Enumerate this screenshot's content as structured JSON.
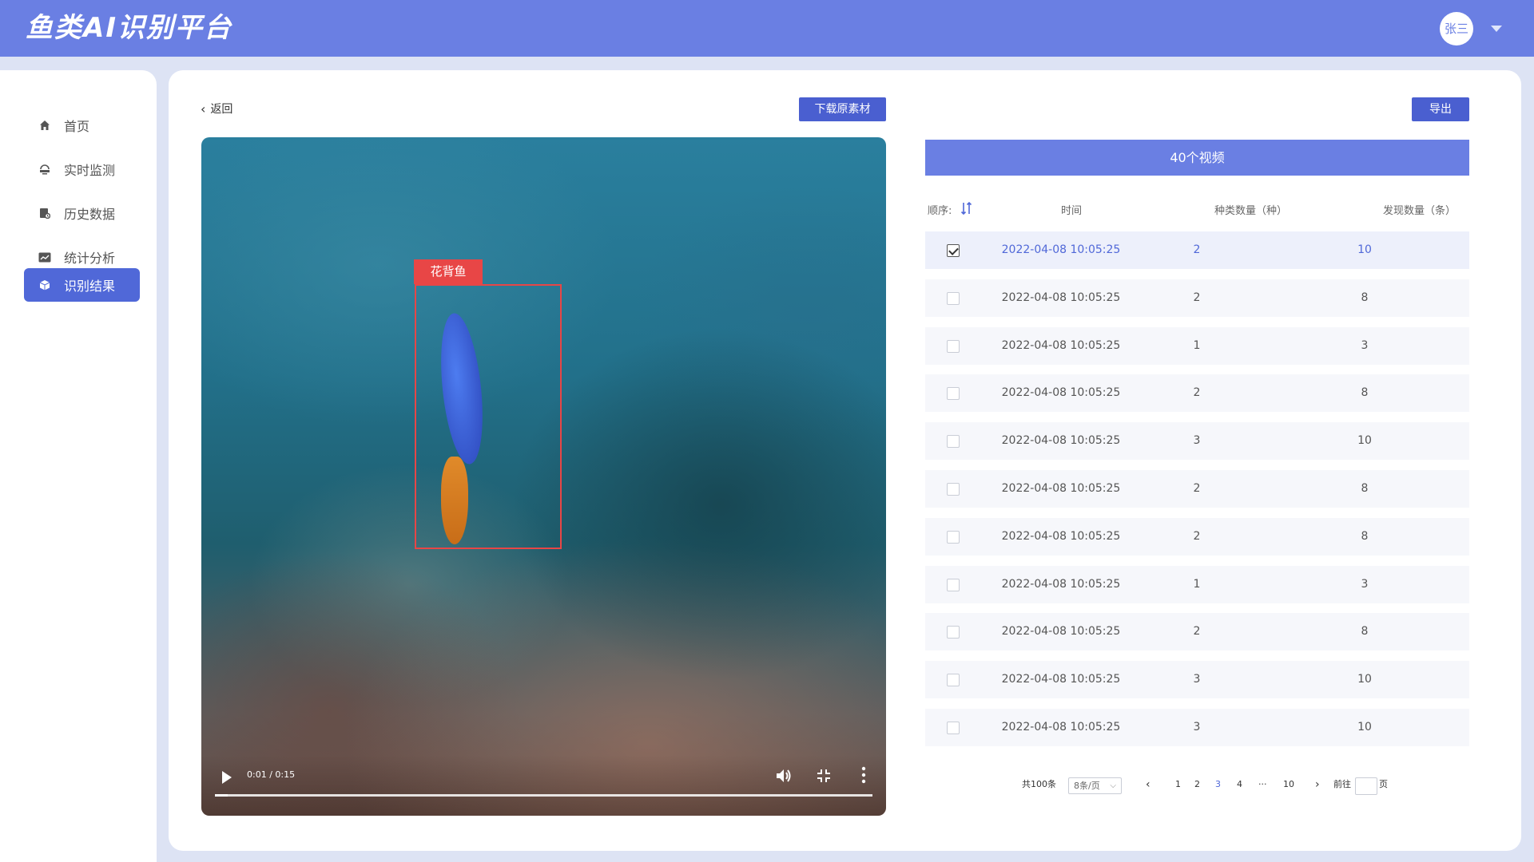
{
  "app": {
    "title": "鱼类AI识别平台"
  },
  "user": {
    "name": "张三"
  },
  "sidebar": {
    "items": [
      {
        "label": "首页",
        "icon": "home-icon"
      },
      {
        "label": "实时监测",
        "icon": "monitor-icon"
      },
      {
        "label": "历史数据",
        "icon": "history-icon"
      },
      {
        "label": "统计分析",
        "icon": "chart-icon"
      },
      {
        "label": "识别结果",
        "icon": "cube-icon",
        "active": true
      }
    ]
  },
  "toolbar": {
    "back_label": "返回",
    "download_label": "下载原素材",
    "export_label": "导出"
  },
  "video": {
    "detection_label": "花背鱼",
    "time_display": "0:01 / 0:15",
    "progress": 0.02
  },
  "list": {
    "header": "40个视频",
    "sort_label": "顺序:",
    "columns": {
      "time": "时间",
      "species": "种类数量（种）",
      "found": "发现数量（条）"
    },
    "rows": [
      {
        "time": "2022-04-08 10:05:25",
        "species": "2",
        "found": "10",
        "checked": true
      },
      {
        "time": "2022-04-08 10:05:25",
        "species": "2",
        "found": "8",
        "checked": false
      },
      {
        "time": "2022-04-08 10:05:25",
        "species": "1",
        "found": "3",
        "checked": false
      },
      {
        "time": "2022-04-08 10:05:25",
        "species": "2",
        "found": "8",
        "checked": false
      },
      {
        "time": "2022-04-08 10:05:25",
        "species": "3",
        "found": "10",
        "checked": false
      },
      {
        "time": "2022-04-08 10:05:25",
        "species": "2",
        "found": "8",
        "checked": false
      },
      {
        "time": "2022-04-08 10:05:25",
        "species": "2",
        "found": "8",
        "checked": false
      },
      {
        "time": "2022-04-08 10:05:25",
        "species": "1",
        "found": "3",
        "checked": false
      },
      {
        "time": "2022-04-08 10:05:25",
        "species": "2",
        "found": "8",
        "checked": false
      },
      {
        "time": "2022-04-08 10:05:25",
        "species": "3",
        "found": "10",
        "checked": false
      },
      {
        "time": "2022-04-08 10:05:25",
        "species": "3",
        "found": "10",
        "checked": false
      }
    ]
  },
  "pagination": {
    "total": "共100条",
    "page_size": "8条/页",
    "pages": [
      "1",
      "2",
      "3",
      "4",
      "···",
      "10"
    ],
    "current": "3",
    "goto_prefix": "前往",
    "goto_suffix": "页"
  },
  "colors": {
    "primary": "#6a7fe3",
    "accent": "#5068d8",
    "detection": "#e84646"
  }
}
